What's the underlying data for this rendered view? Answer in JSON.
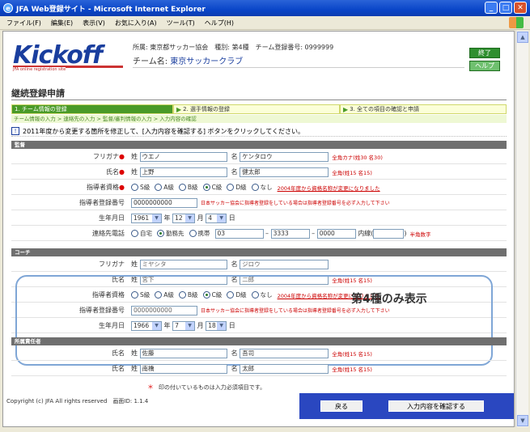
{
  "window": {
    "title": "JFA Web登録サイト - Microsoft Internet Explorer",
    "menu": [
      "ファイル(F)",
      "編集(E)",
      "表示(V)",
      "お気に入り(A)",
      "ツール(T)",
      "ヘルプ(H)"
    ]
  },
  "header": {
    "logo": "Kickoff",
    "logo_sub": "JFA online registration site",
    "affiliation_line": "所属: 東京都サッカー協会　種別: 第4種　チーム登録番号: 0999999",
    "team_label": "チーム名:",
    "team_name": "東京サッカークラブ",
    "end_button": "終了",
    "help_button": "ヘルプ"
  },
  "page_title": "継続登録申請",
  "steps": [
    {
      "label": "1. チーム情報の登録"
    },
    {
      "label": "2. 選手情報の登録"
    },
    {
      "label": "3. 全ての項目の確認と申請"
    }
  ],
  "breadcrumb": "チーム情報の入力 > 連絡先の入力 > 監督/審判情報の入力 > 入力内容の確認",
  "notice": "2011年度から変更する箇所を修正して、[入力内容を確認する] ボタンをクリックしてください。",
  "sections": {
    "manager": "監督",
    "coach": "コーチ",
    "officer": "所属責任者"
  },
  "manager": {
    "furigana_label": "フリガナ",
    "sei": "姓",
    "mei": "名",
    "furigana_sei": "ウエノ",
    "furigana_mei": "ケンタロウ",
    "furigana_note": "全角カナ(姓30 名30)",
    "name_label": "氏名",
    "name_sei": "上野",
    "name_mei": "健太郎",
    "name_note": "全角(姓15 名15)",
    "qual_label": "指導者資格",
    "qual_options": [
      "S級",
      "A級",
      "B級",
      "C級",
      "D級",
      "なし"
    ],
    "qual_selected": "C級",
    "qual_link": "2004年度から資格名称が変更になりました",
    "reg_label": "指導者登録番号",
    "reg_value": "0000000000",
    "reg_note": "日本サッカー協会に指導者登録をしている場合は指導者登録番号を必ず入力して下さい",
    "dob_label": "生年月日",
    "dob_year": "1961",
    "dob_month": "12",
    "dob_day": "4",
    "year_unit": "年",
    "month_unit": "月",
    "day_unit": "日",
    "phone_label": "連絡先電話",
    "phone_options": [
      "自宅",
      "勤務先",
      "携帯"
    ],
    "phone_selected": "勤務先",
    "phone1": "03",
    "phone2": "3333",
    "phone3": "0000",
    "ext_label": "内線(",
    "ext_close": ")",
    "phone_note": "半角数字"
  },
  "coach": {
    "furigana_label": "フリガナ",
    "furigana_sei": "ミヤシタ",
    "furigana_mei": "ジロウ",
    "name_label": "氏名",
    "name_sei": "宮下",
    "name_mei": "二郎",
    "name_note": "全角(姓15 名15)",
    "qual_label": "指導者資格",
    "qual_selected": "C級",
    "reg_label": "指導者登録番号",
    "reg_value": "0000000000",
    "dob_label": "生年月日",
    "dob_year": "1966",
    "dob_month": "7",
    "dob_day": "18",
    "callout": "第4種のみ表示"
  },
  "officer": {
    "rows": [
      {
        "label": "氏名",
        "sei": "佐藤",
        "mei": "吾司",
        "note": "全角(姓15 名15)"
      },
      {
        "label": "氏名",
        "sei": "南橋",
        "mei": "太郎",
        "note": "全角(姓15 名15)"
      }
    ]
  },
  "required_note": "印の付いているものは入力必須項目です。",
  "required_mark": "＊",
  "copyright": "Copyright (c) JFA All rights reserved　画面ID: 1.1.4",
  "footer": {
    "back_button": "戻る",
    "confirm_button": "入力内容を確認する"
  }
}
